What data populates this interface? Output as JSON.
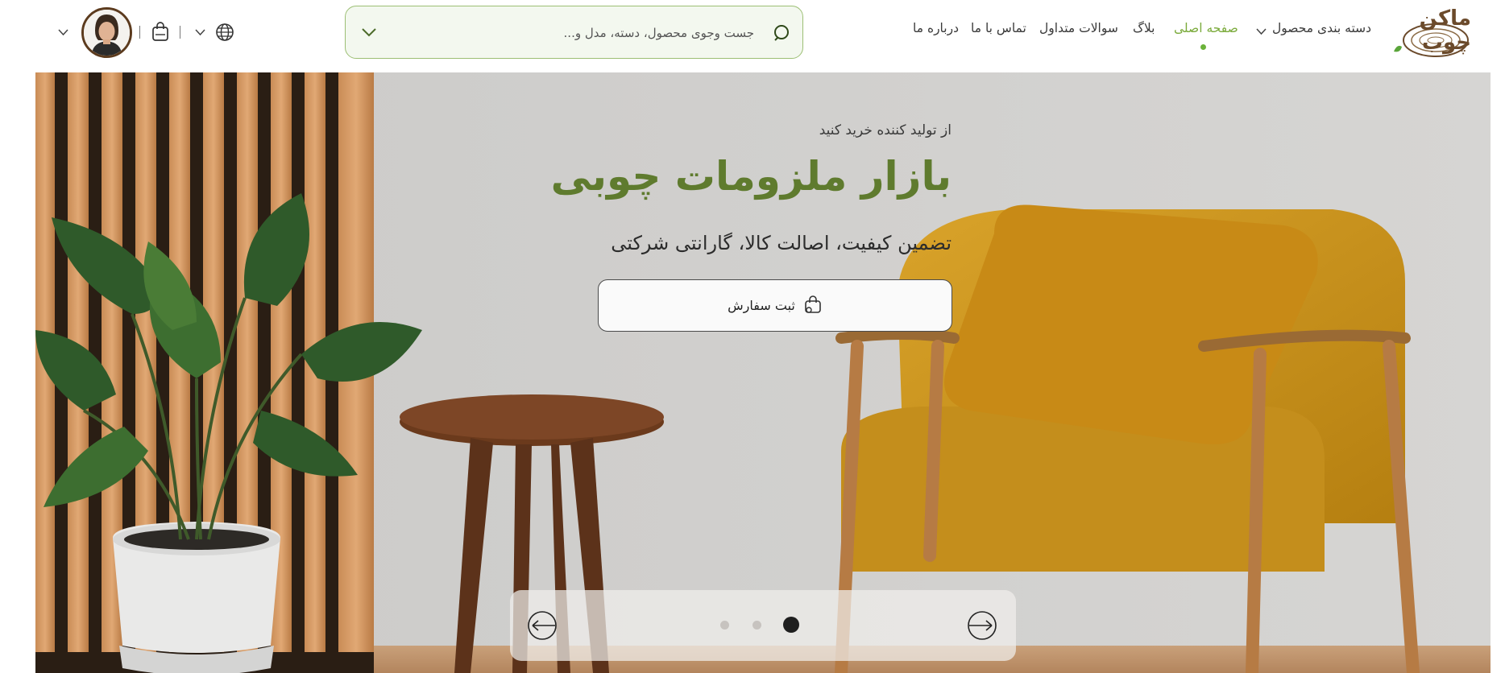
{
  "brand": {
    "logo_text": "ماکن چوب"
  },
  "nav": {
    "items": [
      {
        "label": "دسته بندی محصول",
        "has_dropdown": true,
        "active": false
      },
      {
        "label": "صفحه اصلی",
        "active": true
      },
      {
        "label": "بلاگ",
        "active": false
      },
      {
        "label": "سوالات متداول",
        "active": false
      },
      {
        "label": "تماس با ما",
        "active": false
      },
      {
        "label": "درباره ما",
        "active": false
      }
    ]
  },
  "search": {
    "placeholder": "جست وجوی محصول، دسته، مدل و...",
    "value": ""
  },
  "header_icons": [
    "globe-icon",
    "chevron-down-icon",
    "shopping-bag-icon",
    "avatar",
    "chevron-down-icon"
  ],
  "hero": {
    "subtitle": "از تولید کننده خرید کنید",
    "title": "بازار ملزومات چوبی",
    "description": "تضمین کیفیت، اصالت کالا، گارانتی شرکتی",
    "cta_label": "ثبت سفارش"
  },
  "slider": {
    "total": 3,
    "active_index": 0
  },
  "colors": {
    "accent_green": "#5f7b2e",
    "nav_active": "#7aaa3a",
    "search_border": "#9cbf74",
    "search_bg": "#f3f8ef",
    "brand_brown": "#6b4a2b"
  }
}
